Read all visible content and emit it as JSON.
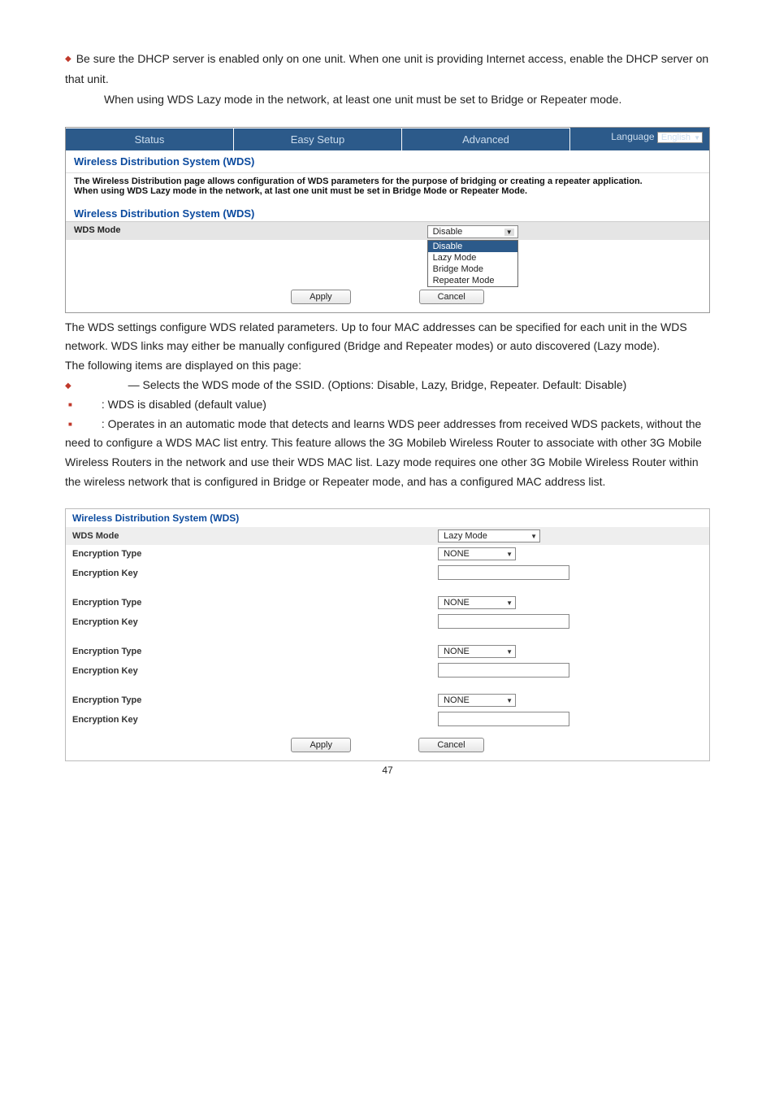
{
  "doc": {
    "intro_sentence": "Be sure the DHCP server is enabled only on one unit. When one unit is providing Internet access, enable the DHCP server on that unit.",
    "intro2": "When using WDS Lazy mode in the network, at least one unit must be set to Bridge or Repeater mode.",
    "panel1": {
      "tabs": {
        "status": "Status",
        "easy": "Easy Setup",
        "advanced": "Advanced"
      },
      "language_label": "Language",
      "language_value": "English",
      "section_title": "Wireless Distribution System (WDS)",
      "help_l1": "The Wireless Distribution page allows configuration of WDS parameters for the purpose of bridging or creating a repeater application.",
      "help_l2": "When using WDS Lazy mode in the network, at last one unit must be set in Bridge Mode or Repeater Mode.",
      "row_label": "WDS Mode",
      "dd_selected": "Disable",
      "dd_options": [
        "Disable",
        "Lazy Mode",
        "Bridge Mode",
        "Repeater Mode"
      ],
      "btn_apply": "Apply",
      "btn_cancel": "Cancel"
    },
    "mid_paragraph": {
      "p1": "The WDS settings configure WDS related parameters. Up to four MAC addresses can be specified for each unit in the WDS network. WDS links may either be manually configured (Bridge and Repeater modes) or auto discovered (Lazy mode).",
      "p2": "The following items are displayed on this page:",
      "li1": " — Selects the WDS mode of the SSID. (Options: Disable, Lazy, Bridge, Repeater. Default: Disable)",
      "li2": ": WDS is disabled (default value)",
      "li3": ": Operates in an automatic mode that detects and learns WDS peer addresses from received WDS packets, without the need to configure a WDS MAC list entry. This feature allows the 3G Mobileb Wireless Router to associate with other 3G Mobile Wireless Routers in the network and use their WDS MAC list. Lazy mode requires one other 3G Mobile Wireless Router within the wireless network that is configured in Bridge or Repeater mode, and has a configured MAC address list."
    },
    "panel2": {
      "title": "Wireless Distribution System (WDS)",
      "mode_label": "WDS Mode",
      "mode_value": "Lazy Mode",
      "enc_type_label": "Encryption Type",
      "enc_key_label": "Encryption Key",
      "enc_type_value": "NONE",
      "btn_apply": "Apply",
      "btn_cancel": "Cancel"
    },
    "page_number": "47"
  }
}
